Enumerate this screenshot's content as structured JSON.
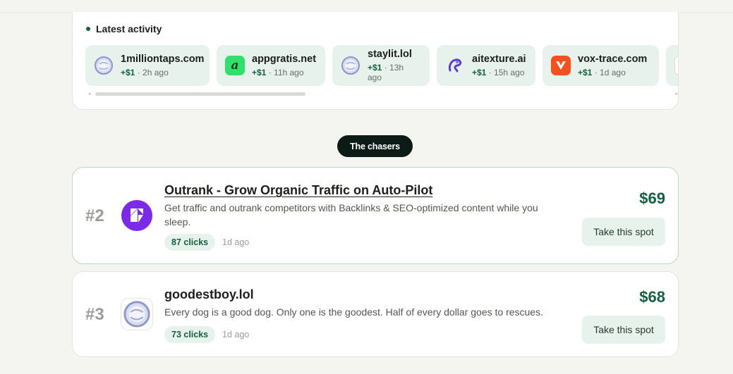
{
  "activity": {
    "title": "Latest activity",
    "items": [
      {
        "domain": "1milliontaps.com",
        "amount": "+$1",
        "time": "· 2h ago",
        "icon": "globe-icon"
      },
      {
        "domain": "appgratis.net",
        "amount": "+$1",
        "time": "· 11h ago",
        "icon": "appgratis-logo-icon"
      },
      {
        "domain": "staylit.lol",
        "amount": "+$1",
        "time": "· 13h ago",
        "icon": "globe-icon"
      },
      {
        "domain": "aitexture.ai",
        "amount": "+$1",
        "time": "· 15h ago",
        "icon": "aitexture-logo-icon"
      },
      {
        "domain": "vox-trace.com",
        "amount": "+$1",
        "time": "· 1d ago",
        "icon": "vox-trace-logo-icon"
      }
    ]
  },
  "section_pill": "The chasers",
  "spots": [
    {
      "rank": "#2",
      "title": "Outrank - Grow Organic Traffic on Auto-Pilot",
      "description": "Get traffic and outrank competitors with Backlinks & SEO-optimized content while you sleep.",
      "clicks": "87 clicks",
      "time": "1d ago",
      "price": "$69",
      "button": "Take this spot",
      "logo": "outrank-logo-icon"
    },
    {
      "rank": "#3",
      "title": "goodestboy.lol",
      "description": "Every dog is a good dog. Only one is the goodest. Half of every dollar goes to rescues.",
      "clicks": "73 clicks",
      "time": "1d ago",
      "price": "$68",
      "button": "Take this spot",
      "logo": "globe-icon"
    }
  ],
  "colors": {
    "accent_green": "#14613f",
    "pill_bg": "#0c1b15",
    "badge_bg": "#e8f2ec",
    "outrank_purple": "#7c2ae8",
    "vox_orange": "#f4511e",
    "appgratis_green": "#2fe06b"
  }
}
